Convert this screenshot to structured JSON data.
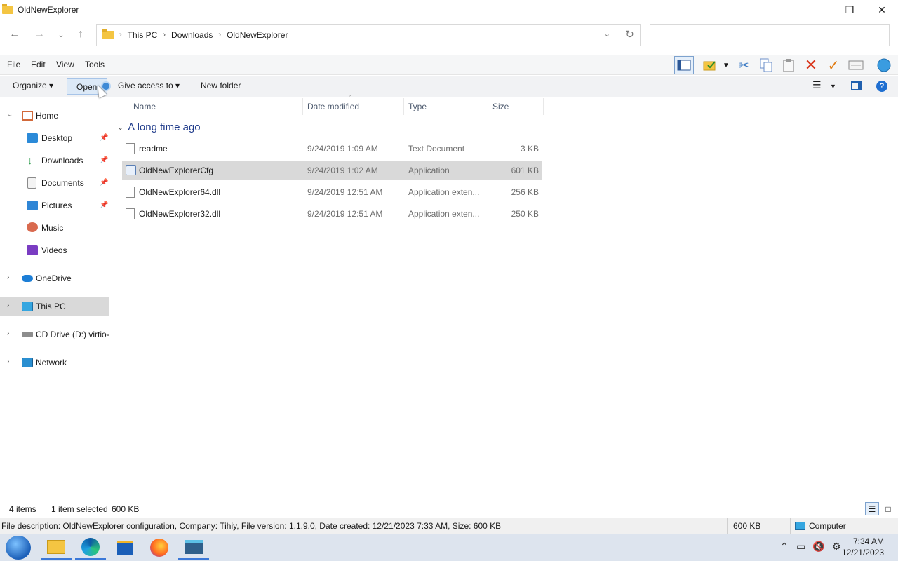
{
  "window": {
    "title": "OldNewExplorer"
  },
  "address": {
    "crumbs": [
      "This PC",
      "Downloads",
      "OldNewExplorer"
    ],
    "search_placeholder": ""
  },
  "menu": {
    "file": "File",
    "edit": "Edit",
    "view": "View",
    "tools": "Tools"
  },
  "commands": {
    "organize": "Organize",
    "open": "Open",
    "give_access": "Give access to",
    "new_folder": "New folder"
  },
  "sidebar": {
    "items": [
      {
        "label": "Home"
      },
      {
        "label": "Desktop"
      },
      {
        "label": "Downloads"
      },
      {
        "label": "Documents"
      },
      {
        "label": "Pictures"
      },
      {
        "label": "Music"
      },
      {
        "label": "Videos"
      },
      {
        "label": "OneDrive"
      },
      {
        "label": "This PC"
      },
      {
        "label": "CD Drive (D:) virtio-win"
      },
      {
        "label": "Network"
      }
    ]
  },
  "columns": {
    "name": "Name",
    "date": "Date modified",
    "type": "Type",
    "size": "Size"
  },
  "group": {
    "label": "A long time ago"
  },
  "files": [
    {
      "name": "readme",
      "date": "9/24/2019 1:09 AM",
      "type": "Text Document",
      "size": "3 KB"
    },
    {
      "name": "OldNewExplorerCfg",
      "date": "9/24/2019 1:02 AM",
      "type": "Application",
      "size": "601 KB"
    },
    {
      "name": "OldNewExplorer64.dll",
      "date": "9/24/2019 12:51 AM",
      "type": "Application exten...",
      "size": "256 KB"
    },
    {
      "name": "OldNewExplorer32.dll",
      "date": "9/24/2019 12:51 AM",
      "type": "Application exten...",
      "size": "250 KB"
    }
  ],
  "status": {
    "count": "4 items",
    "selected": "1 item selected",
    "selected_size": "600 KB"
  },
  "description": {
    "text": "File description: OldNewExplorer configuration, Company: Tihiy, File version: 1.1.9.0, Date created: 12/21/2023 7:33 AM, Size: 600 KB",
    "size": "600 KB",
    "location": "Computer"
  },
  "clock": {
    "time": "7:34 AM",
    "date": "12/21/2023"
  },
  "colors": {
    "accent": "#3b78d8",
    "selection": "#d9d9d9",
    "group_header": "#1e3a8a"
  }
}
